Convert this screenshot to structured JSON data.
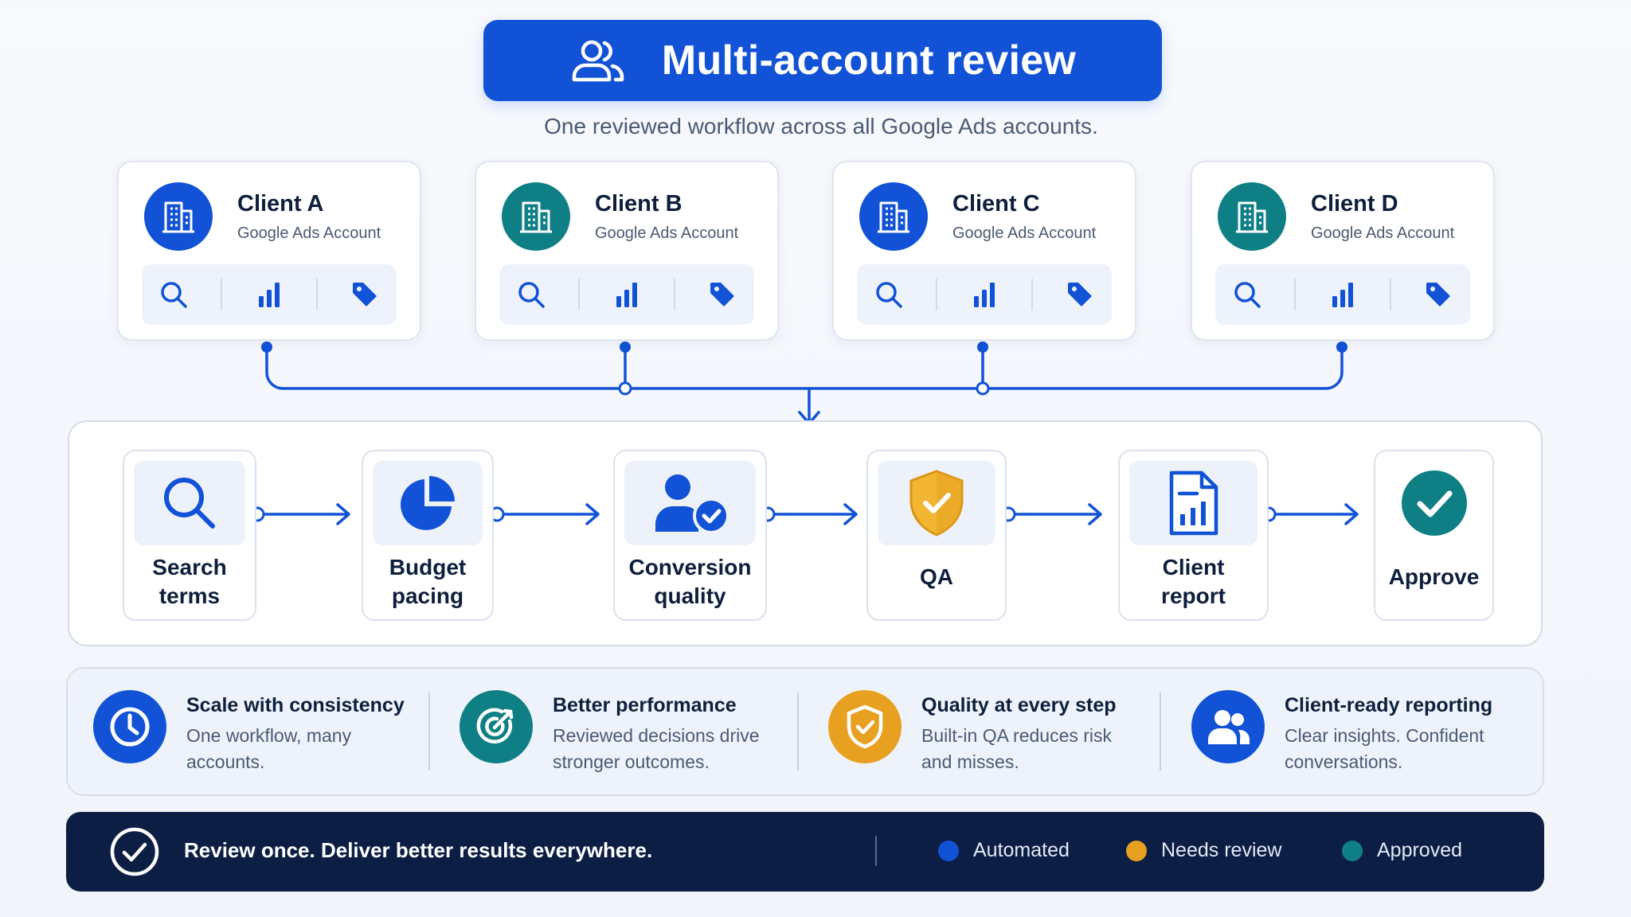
{
  "header": {
    "title": "Multi-account review",
    "subtitle": "One reviewed workflow across all Google Ads accounts."
  },
  "clients": [
    {
      "name": "Client A",
      "subtitle": "Google Ads Account",
      "color": "#1152d6"
    },
    {
      "name": "Client B",
      "subtitle": "Google Ads Account",
      "color": "#0f7f86"
    },
    {
      "name": "Client C",
      "subtitle": "Google Ads Account",
      "color": "#1152d6"
    },
    {
      "name": "Client D",
      "subtitle": "Google Ads Account",
      "color": "#0f7f86"
    }
  ],
  "client_tools": [
    "search-icon",
    "bar-chart-icon",
    "tag-icon"
  ],
  "workflow": {
    "steps": [
      {
        "line1": "Search",
        "line2": "terms",
        "icon": "search-icon"
      },
      {
        "line1": "Budget",
        "line2": "pacing",
        "icon": "pie-chart-icon"
      },
      {
        "line1": "Conversion",
        "line2": "quality",
        "icon": "user-check-icon"
      },
      {
        "line1": "QA",
        "line2": "",
        "icon": "shield-check-icon"
      },
      {
        "line1": "Client",
        "line2": "report",
        "icon": "report-icon"
      },
      {
        "line1": "Approve",
        "line2": "",
        "icon": "check-circle-icon"
      }
    ]
  },
  "benefits": [
    {
      "title": "Scale with consistency",
      "line1": "One workflow, many",
      "line2": "accounts.",
      "icon": "clock-icon",
      "color": "#1152d6"
    },
    {
      "title": "Better performance",
      "line1": "Reviewed decisions drive",
      "line2": "stronger outcomes.",
      "icon": "target-icon",
      "color": "#0f7f86"
    },
    {
      "title": "Quality at every step",
      "line1": "Built-in QA reduces risk",
      "line2": "and misses.",
      "icon": "shield-check-icon",
      "color": "#e8a020"
    },
    {
      "title": "Client-ready reporting",
      "line1": "Clear insights. Confident",
      "line2": "conversations.",
      "icon": "users-icon",
      "color": "#1152d6"
    }
  ],
  "footer": {
    "message": "Review once. Deliver better results everywhere.",
    "legend": [
      {
        "label": "Automated",
        "color": "#1152d6"
      },
      {
        "label": "Needs review",
        "color": "#e8a020"
      },
      {
        "label": "Approved",
        "color": "#0f7f86"
      }
    ]
  }
}
